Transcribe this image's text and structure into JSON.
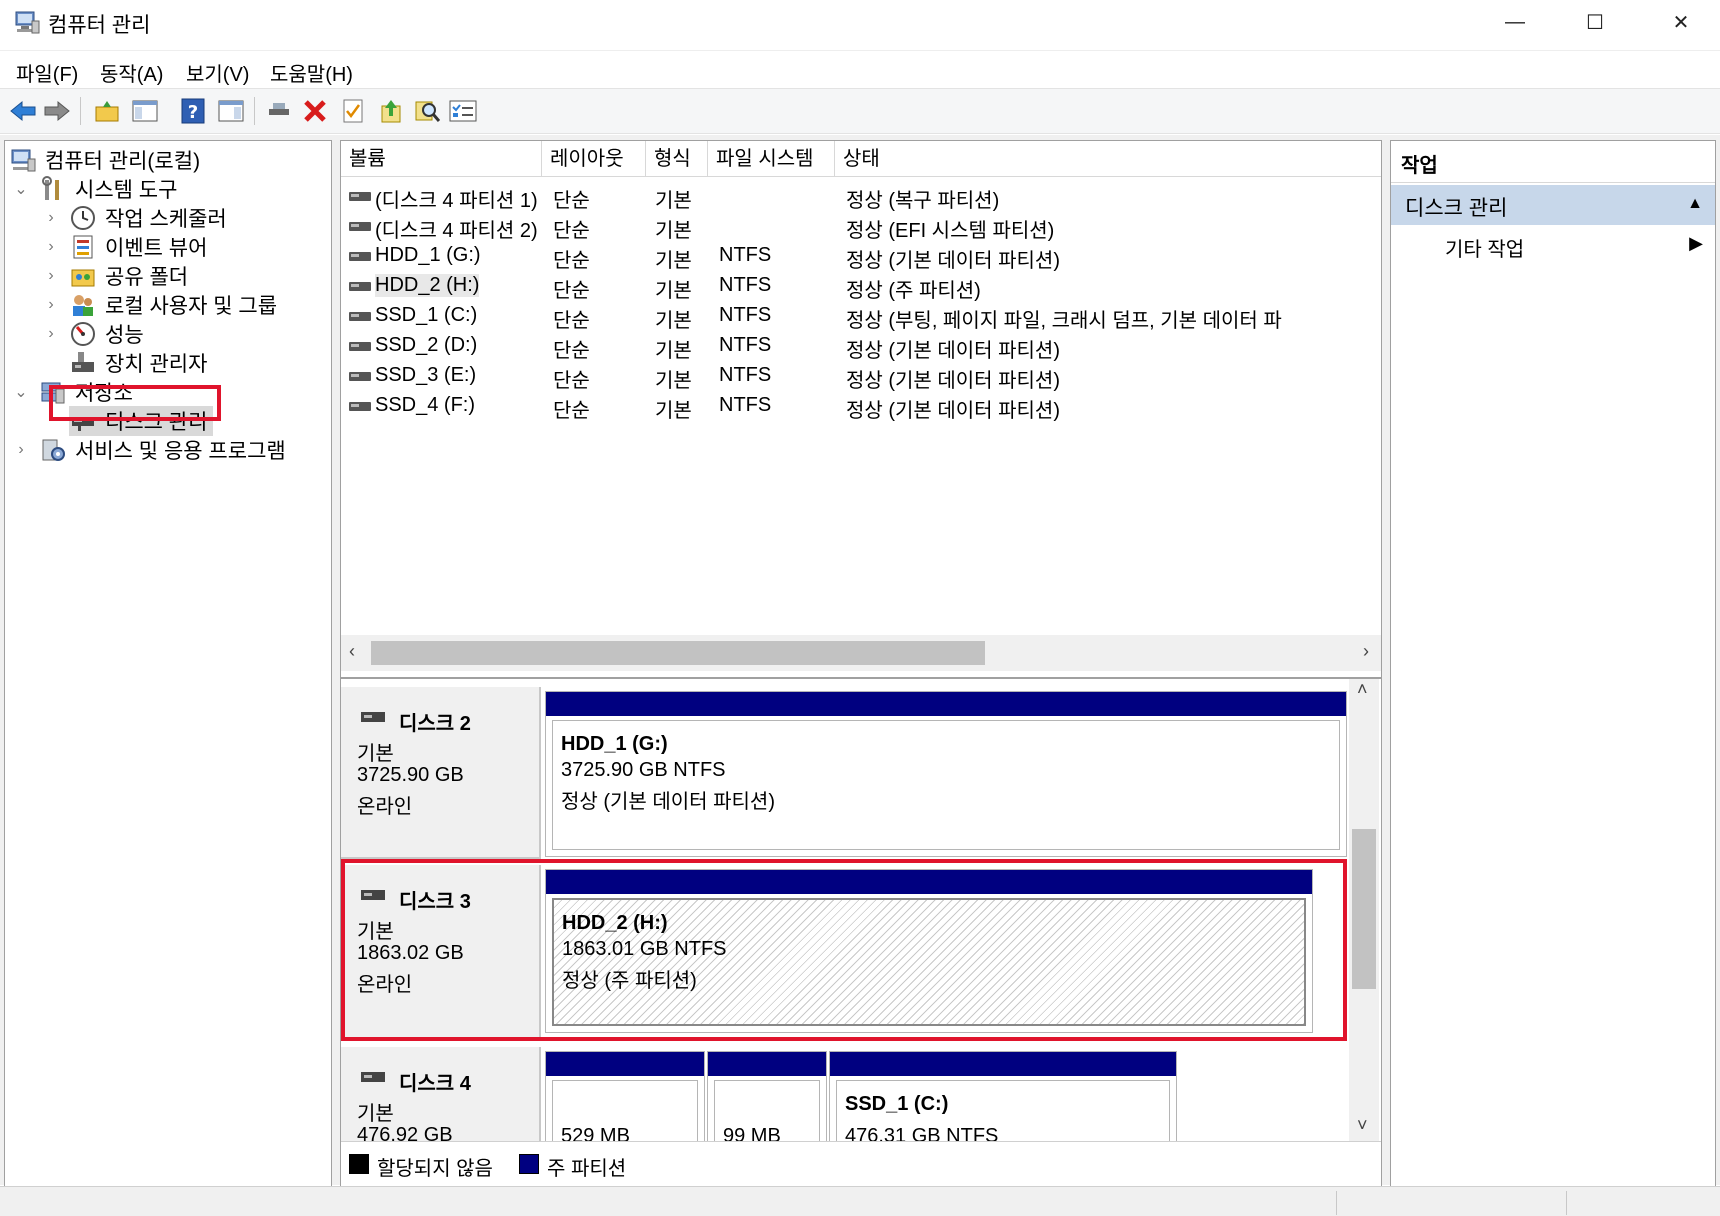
{
  "window": {
    "title": "컴퓨터 관리",
    "minimize": "—",
    "maximize": "☐",
    "close": "✕"
  },
  "menu": [
    "파일(F)",
    "동작(A)",
    "보기(V)",
    "도움말(H)"
  ],
  "toolbar": [
    "back-arrow",
    "forward-arrow",
    "folder-up",
    "show-hide-console-tree",
    "help",
    "show-hide-action-pane",
    "connect",
    "delete",
    "properties",
    "export",
    "find",
    "checklist"
  ],
  "tree": {
    "root": "컴퓨터 관리(로컬)",
    "system_tools": "시스템 도구",
    "task_scheduler": "작업 스케줄러",
    "event_viewer": "이벤트 뷰어",
    "shared_folders": "공유 폴더",
    "local_users": "로컬 사용자 및 그룹",
    "performance": "성능",
    "device_manager": "장치 관리자",
    "storage": "저장소",
    "disk_management": "디스크 관리",
    "services": "서비스 및 응용 프로그램"
  },
  "volumes": {
    "headers": [
      "볼륨",
      "레이아웃",
      "형식",
      "파일 시스템",
      "상태"
    ],
    "rows": [
      [
        "(디스크 4 파티션 1)",
        "단순",
        "기본",
        "",
        "정상 (복구 파티션)"
      ],
      [
        "(디스크 4 파티션 2)",
        "단순",
        "기본",
        "",
        "정상 (EFI 시스템 파티션)"
      ],
      [
        "HDD_1 (G:)",
        "단순",
        "기본",
        "NTFS",
        "정상 (기본 데이터 파티션)"
      ],
      [
        "HDD_2 (H:)",
        "단순",
        "기본",
        "NTFS",
        "정상 (주 파티션)"
      ],
      [
        "SSD_1 (C:)",
        "단순",
        "기본",
        "NTFS",
        "정상 (부팅, 페이지 파일, 크래시 덤프, 기본 데이터 파"
      ],
      [
        "SSD_2 (D:)",
        "단순",
        "기본",
        "NTFS",
        "정상 (기본 데이터 파티션)"
      ],
      [
        "SSD_3 (E:)",
        "단순",
        "기본",
        "NTFS",
        "정상 (기본 데이터 파티션)"
      ],
      [
        "SSD_4 (F:)",
        "단순",
        "기본",
        "NTFS",
        "정상 (기본 데이터 파티션)"
      ]
    ]
  },
  "disks": {
    "disk2": {
      "name": "디스크 2",
      "type": "기본",
      "size": "3725.90 GB",
      "status": "온라인",
      "partition": {
        "title": "HDD_1  (G:)",
        "size": "3725.90 GB NTFS",
        "status": "정상 (기본 데이터 파티션)"
      }
    },
    "disk3": {
      "name": "디스크 3",
      "type": "기본",
      "size": "1863.02 GB",
      "status": "온라인",
      "partition": {
        "title": "HDD_2  (H:)",
        "size": "1863.01 GB NTFS",
        "status": "정상 (주 파티션)"
      }
    },
    "disk4": {
      "name": "디스크 4",
      "type": "기본",
      "size": "476.92 GB",
      "partitions": [
        {
          "size": "529 MB"
        },
        {
          "size": "99 MB"
        },
        {
          "title": "SSD_1  (C:)",
          "size": "476.31 GB NTFS"
        }
      ]
    }
  },
  "legend": {
    "unallocated": "할당되지 않음",
    "primary": "주 파티션",
    "colors": {
      "unallocated": "#000000",
      "primary": "#000080"
    }
  },
  "actions": {
    "header": "작업",
    "section": "디스크 관리",
    "more": "기타 작업"
  },
  "colors": {
    "highlight_red": "#e0142c",
    "partition_bar": "#000080",
    "action_section": "#c7d7ea"
  }
}
